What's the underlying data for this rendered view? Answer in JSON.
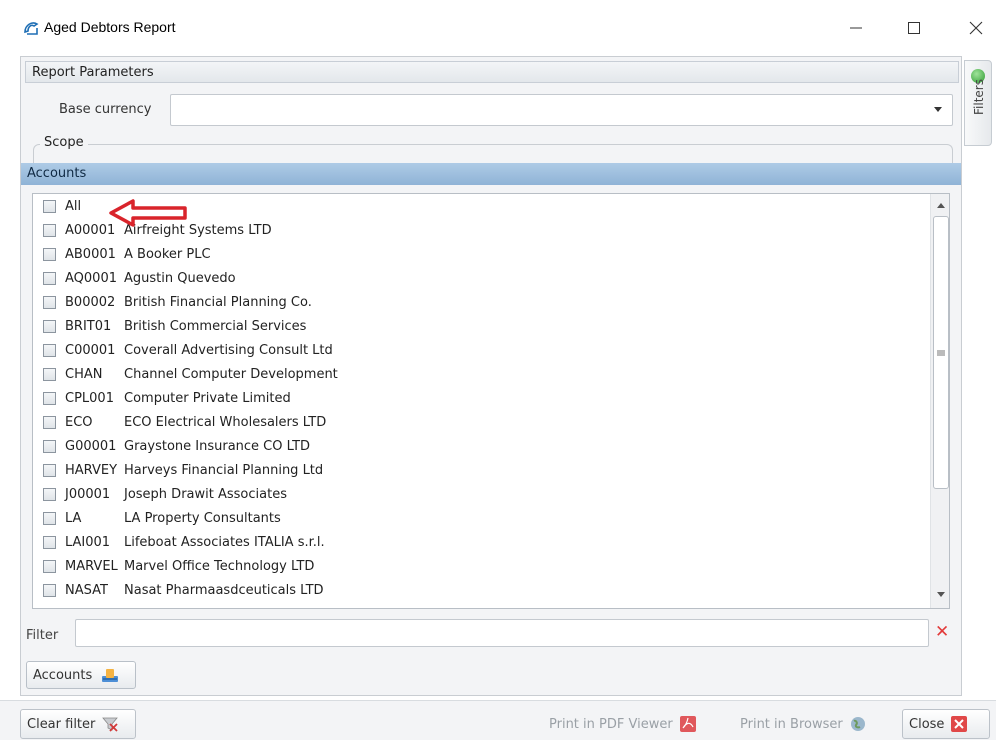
{
  "window": {
    "title": "Aged Debtors Report",
    "minimize": "—",
    "maximize": "☐",
    "close": "✕"
  },
  "report_parameters": {
    "header": "Report Parameters",
    "base_currency_label": "Base currency",
    "base_currency_value": "",
    "scope_label": "Scope"
  },
  "accounts": {
    "header": "Accounts",
    "items": [
      {
        "code": "All",
        "name": "",
        "checked": false
      },
      {
        "code": "A00001",
        "name": "Airfreight Systems LTD",
        "checked": false
      },
      {
        "code": "AB0001",
        "name": "A Booker PLC",
        "checked": false
      },
      {
        "code": "AQ0001",
        "name": "Agustin Quevedo",
        "checked": false
      },
      {
        "code": "B00002",
        "name": "British Financial Planning Co.",
        "checked": false
      },
      {
        "code": "BRIT01",
        "name": "British Commercial Services",
        "checked": false
      },
      {
        "code": "C00001",
        "name": "Coverall Advertising Consult Ltd",
        "checked": false
      },
      {
        "code": "CHAN",
        "name": "Channel Computer Development",
        "checked": false
      },
      {
        "code": "CPL001",
        "name": "Computer Private Limited",
        "checked": false
      },
      {
        "code": "ECO",
        "name": "ECO Electrical Wholesalers LTD",
        "checked": false
      },
      {
        "code": "G00001",
        "name": "Graystone Insurance CO LTD",
        "checked": false
      },
      {
        "code": "HARVEY",
        "name": "Harveys Financial Planning Ltd",
        "checked": false
      },
      {
        "code": "J00001",
        "name": "Joseph Drawit Associates",
        "checked": false
      },
      {
        "code": "LA",
        "name": "LA Property Consultants",
        "checked": false
      },
      {
        "code": "LAI001",
        "name": "Lifeboat Associates ITALIA s.r.l.",
        "checked": false
      },
      {
        "code": "MARVEL",
        "name": "Marvel Office Technology LTD",
        "checked": false
      },
      {
        "code": "NASAT",
        "name": "Nasat Pharmaasdceuticals LTD",
        "checked": false
      }
    ],
    "filter_label": "Filter",
    "filter_value": "",
    "tab_label": "Accounts"
  },
  "side_tab": {
    "label": "Filters"
  },
  "toolbar": {
    "clear_filter": "Clear filter",
    "print_pdf": "Print in PDF Viewer",
    "print_browser": "Print in Browser",
    "close": "Close"
  },
  "colors": {
    "accounts_header": "#9fc0e0",
    "annotation_arrow": "#d9242b",
    "filter_clear": "#e23a3a",
    "filters_dot": "#3aa63a"
  }
}
